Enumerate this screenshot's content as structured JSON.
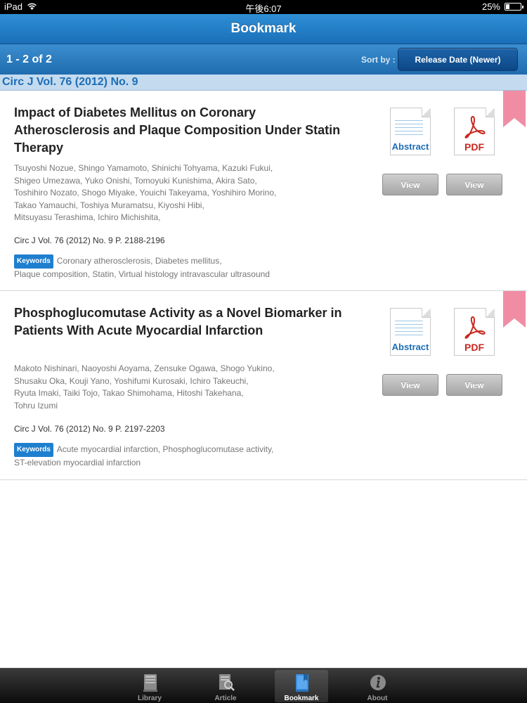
{
  "status_bar": {
    "device": "iPad",
    "time": "午後6:07",
    "battery": "25%",
    "battery_level": 0.25
  },
  "navbar": {
    "title": "Bookmark"
  },
  "toolbar": {
    "count": "1 - 2 of 2",
    "sort_label": "Sort by :",
    "sort_value": "Release Date (Newer)"
  },
  "section": {
    "label": "Circ J Vol. 76 (2012) No. 9"
  },
  "articles": [
    {
      "title": "Impact of Diabetes Mellitus on Coronary Atherosclerosis and Plaque Composition Under Statin Therapy",
      "authors": [
        "Tsuyoshi Nozue,  Shingo Yamamoto,  Shinichi Tohyama,  Kazuki Fukui,",
        "Shigeo Umezawa,  Yuko Onishi,  Tomoyuki Kunishima,  Akira Sato,",
        "Toshihiro Nozato,  Shogo Miyake,  Youichi Takeyama,  Yoshihiro Morino,",
        "Takao Yamauchi,  Toshiya Muramatsu,  Kiyoshi Hibi,",
        "Mitsuyasu Terashima,  Ichiro Michishita,"
      ],
      "citation": "Circ J Vol. 76 (2012) No. 9 P. 2188-2196",
      "keywords_label": "Keywords",
      "keywords": [
        "Coronary atherosclerosis,  Diabetes mellitus,",
        "Plaque composition,  Statin,  Virtual histology intravascular ultrasound"
      ],
      "abstract_label": "Abstract",
      "pdf_label": "PDF",
      "view_label": "View"
    },
    {
      "title": "Phosphoglucomutase Activity as a Novel Biomarker in Patients With Acute Myocardial Infarction",
      "authors": [
        "Makoto Nishinari,  Naoyoshi Aoyama,  Zensuke Ogawa,  Shogo Yukino,",
        "Shusaku Oka,  Kouji Yano,  Yoshifumi Kurosaki,  Ichiro Takeuchi,",
        "Ryuta Imaki,  Taiki Tojo,  Takao Shimohama,  Hitoshi Takehana,",
        "Tohru Izumi"
      ],
      "citation": "Circ J Vol. 76 (2012) No. 9 P. 2197-2203",
      "keywords_label": "Keywords",
      "keywords": [
        "Acute myocardial infarction,  Phosphoglucomutase activity,",
        "ST-elevation myocardial infarction"
      ],
      "abstract_label": "Abstract",
      "pdf_label": "PDF",
      "view_label": "View"
    }
  ],
  "tabs": [
    {
      "label": "Library",
      "icon": "library-icon",
      "active": false
    },
    {
      "label": "Article",
      "icon": "article-search-icon",
      "active": false
    },
    {
      "label": "Bookmark",
      "icon": "bookmark-icon",
      "active": true
    },
    {
      "label": "About",
      "icon": "info-icon",
      "active": false
    }
  ],
  "colors": {
    "nav_blue": "#1f6cae",
    "section_bg": "#c4dbef",
    "accent_text": "#1d6db6",
    "ribbon_pink": "#f08da5",
    "pdf_red": "#c8281e"
  }
}
